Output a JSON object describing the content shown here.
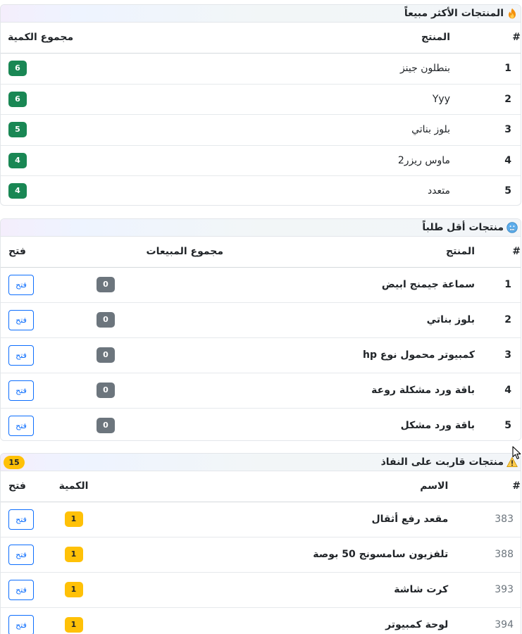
{
  "best_sellers": {
    "title": "المنتجات الأكثر مبيعاً",
    "icon": "fire-icon",
    "headers": {
      "num": "#",
      "product": "المنتج",
      "total_qty": "مجموع الكمية"
    },
    "rows": [
      {
        "rank": "1",
        "name": "بنطلون جينز",
        "qty": "6"
      },
      {
        "rank": "2",
        "name": "Yyy",
        "qty": "6"
      },
      {
        "rank": "3",
        "name": "بلوز بناتي",
        "qty": "5"
      },
      {
        "rank": "4",
        "name": "ماوس ريزر2",
        "qty": "4"
      },
      {
        "rank": "5",
        "name": "متعدد",
        "qty": "4"
      }
    ]
  },
  "least_demanded": {
    "title": "منتجات أقل طلباً",
    "icon": "cold-face-icon",
    "headers": {
      "num": "#",
      "product": "المنتج",
      "total_sales": "مجموع المبيعات",
      "open": "فتح"
    },
    "rows": [
      {
        "rank": "1",
        "name": "سماعة جيمنج ابيض",
        "sales": "0",
        "open_label": "فتح"
      },
      {
        "rank": "2",
        "name": "بلوز بناتي",
        "sales": "0",
        "open_label": "فتح"
      },
      {
        "rank": "3",
        "name": "كمبيوتر محمول نوع hp",
        "sales": "0",
        "open_label": "فتح"
      },
      {
        "rank": "4",
        "name": "باقة ورد مشكلة روعة",
        "sales": "0",
        "open_label": "فتح"
      },
      {
        "rank": "5",
        "name": "باقة ورد مشكل",
        "sales": "0",
        "open_label": "فتح"
      }
    ]
  },
  "low_stock": {
    "title": "منتجات قاربت على النفاذ",
    "icon": "warning-icon",
    "count": "15",
    "headers": {
      "num": "#",
      "name": "الاسم",
      "qty": "الكمية",
      "open": "فتح"
    },
    "rows": [
      {
        "id": "383",
        "name": "مقعد رفع أثقال",
        "qty": "1",
        "open_label": "فتح"
      },
      {
        "id": "388",
        "name": "تلفزيون سامسونج 50 بوصة",
        "qty": "1",
        "open_label": "فتح"
      },
      {
        "id": "393",
        "name": "كرت شاشة",
        "qty": "1",
        "open_label": "فتح"
      },
      {
        "id": "394",
        "name": "لوحة كمبيوتر",
        "qty": "1",
        "open_label": "فتح"
      }
    ]
  },
  "colors": {
    "green_badge": "#198754",
    "gray_badge": "#6c757d",
    "yellow_badge": "#ffc107",
    "primary": "#0d6efd"
  }
}
